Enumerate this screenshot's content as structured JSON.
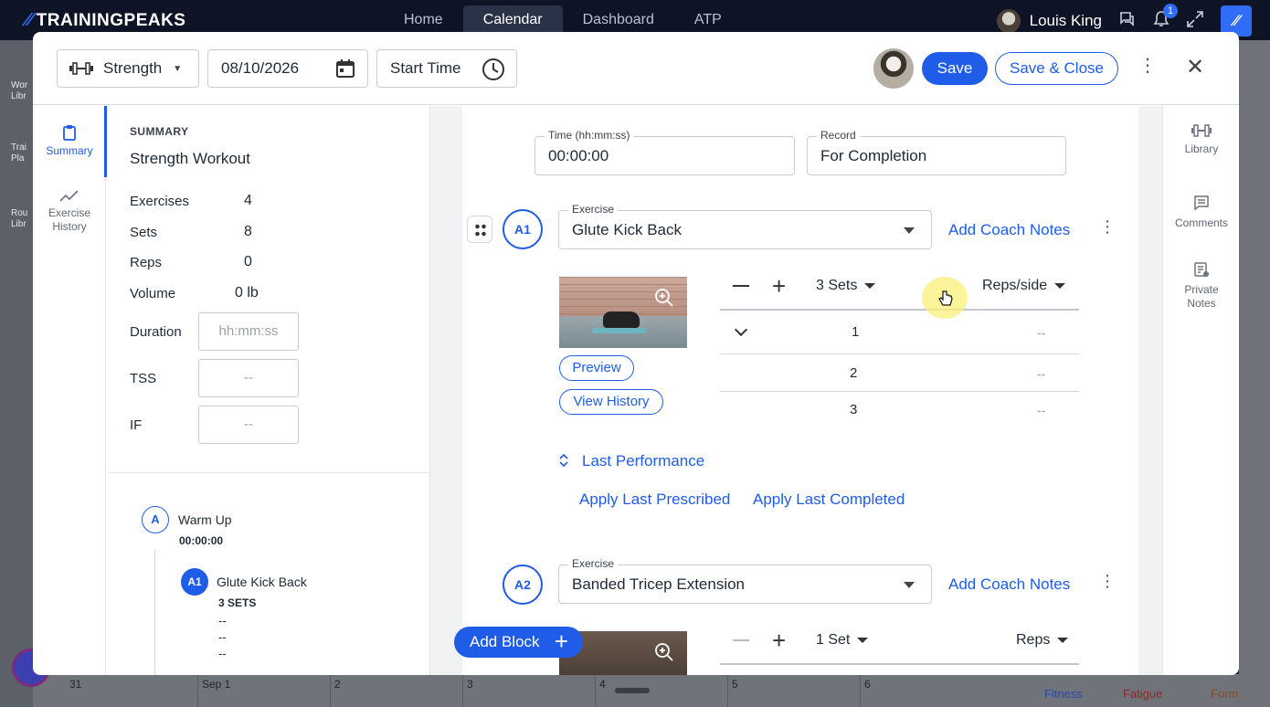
{
  "app": {
    "brand": "TRAININGPEAKS",
    "nav": [
      "Home",
      "Calendar",
      "Dashboard",
      "ATP"
    ],
    "active_nav": "Calendar",
    "user_name": "Louis King",
    "notification_count": "1"
  },
  "background": {
    "calendar_dates": [
      "31",
      "Sep 1",
      "2",
      "3",
      "4",
      "5",
      "6"
    ],
    "metrics": [
      "Fitness",
      "Fatigue",
      "Form"
    ]
  },
  "header": {
    "workout_type": "Strength",
    "date": "08/10/2026",
    "start_time_label": "Start Time",
    "save_label": "Save",
    "save_close_label": "Save & Close"
  },
  "left_rail": {
    "summary_label": "Summary",
    "history_label": "Exercise History"
  },
  "summary": {
    "caption": "SUMMARY",
    "title": "Strength Workout",
    "stats": [
      {
        "label": "Exercises",
        "value": "4"
      },
      {
        "label": "Sets",
        "value": "8"
      },
      {
        "label": "Reps",
        "value": "0"
      },
      {
        "label": "Volume",
        "value": "0 lb"
      }
    ],
    "duration_label": "Duration",
    "duration_placeholder": "hh:mm:ss",
    "tss_label": "TSS",
    "tss_value": "--",
    "if_label": "IF",
    "if_value": "--",
    "tree": {
      "block_letter": "A",
      "block_name": "Warm Up",
      "block_time": "00:00:00",
      "item_code": "A1",
      "item_name": "Glute Kick Back",
      "item_sets": "3 SETS",
      "item_values": [
        "--",
        "--",
        "--"
      ]
    }
  },
  "block": {
    "time_label": "Time (hh:mm:ss)",
    "time_value": "00:00:00",
    "record_label": "Record",
    "record_value": "For Completion"
  },
  "exercises": [
    {
      "code": "A1",
      "field_label": "Exercise",
      "name": "Glute Kick Back",
      "coach_notes": "Add Coach Notes",
      "preview": "Preview",
      "view_history": "View History",
      "sets_label": "3 Sets",
      "reps_label": "Reps/side",
      "rows": [
        {
          "set": "1",
          "value": "--"
        },
        {
          "set": "2",
          "value": "--"
        },
        {
          "set": "3",
          "value": "--"
        }
      ],
      "last_performance": "Last Performance",
      "apply_prescribed": "Apply Last Prescribed",
      "apply_completed": "Apply Last Completed"
    },
    {
      "code": "A2",
      "field_label": "Exercise",
      "name": "Banded Tricep Extension",
      "coach_notes": "Add Coach Notes",
      "sets_label": "1 Set",
      "reps_label": "Reps"
    }
  ],
  "add_block_label": "Add Block",
  "right_rail": {
    "library": "Library",
    "comments": "Comments",
    "private_notes": "Private Notes"
  },
  "colors": {
    "accent": "#1f5ce8",
    "topbar": "#0e1426"
  }
}
